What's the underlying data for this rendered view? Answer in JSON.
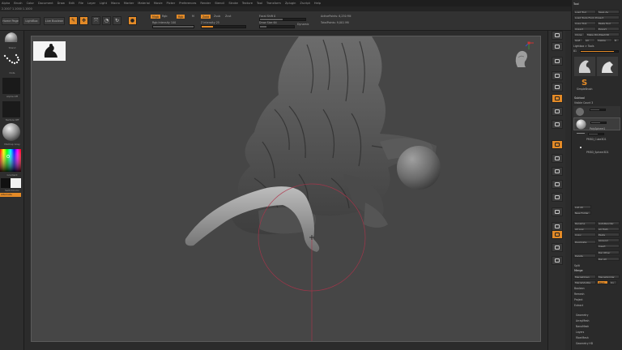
{
  "menu": [
    "Alpha",
    "Brush",
    "Color",
    "Document",
    "Draw",
    "Edit",
    "File",
    "Layer",
    "Light",
    "Macro",
    "Marker",
    "Material",
    "Movie",
    "Picker",
    "Preferences",
    "Render",
    "Stencil",
    "Stroke",
    "Texture",
    "Tool",
    "Transform",
    "Zplugin",
    "Zscript",
    "Help"
  ],
  "subbar_text": "2.2007 1.1000 1.1000",
  "shelf": {
    "home_page": "Home Page",
    "lightbox": "LightBox",
    "live_boolean": "Live Boolean",
    "mrgb": "Mrgb",
    "rgb": "Rgb",
    "m": "M",
    "zadd": "Zadd",
    "zsub": "Zsub",
    "zcut": "Zcut",
    "rgb_intensity": "Rgb Intensity 100",
    "z_intensity": "Z Intensity 25",
    "focal_shift": "Focal Shift 0",
    "draw_size": "Draw Size 64",
    "dynamic": "Dynamic",
    "active_points": "ActivePoints: 6,250 Mil",
    "total_points": "TotalPoints: 9,001 Mil"
  },
  "left": {
    "brush_label": "Stand",
    "stroke_label": "Dots",
    "alpha_label": "Alpha Off",
    "texture_label": "Texture Off",
    "material_label": "MatCap Gray",
    "gradient_label": "Gradient",
    "switch_label": "SwitchColor",
    "alternate_label": "Alternate"
  },
  "tool": {
    "title": "Tool",
    "buttons": [
      [
        "Load Tool",
        "Save As"
      ],
      [
        "Load Tools From Project"
      ],
      [
        "Copy Tool",
        "Paste Tool"
      ],
      [
        "Import",
        "Export"
      ],
      [
        "Clone",
        "Make PolyMesh3D"
      ],
      [
        "GoZ",
        "All",
        "Visible",
        "R"
      ]
    ],
    "lightbox_tools": "Lightbox > Tools",
    "current_tool": "SimpleBrush",
    "tool_count": "81",
    "subtool_header": "Subtool",
    "visible_count": "Visible Count 3",
    "subtools": [
      "PolySphere1",
      "PM3D_Cube3D1",
      "PM3D_Sphere3D1"
    ],
    "list_all": "List All",
    "new_folder": "New Folder",
    "actions": [
      [
        "Rename",
        "AutoReorder"
      ],
      [
        "All Low",
        "All High"
      ],
      [
        "Copy",
        "Paste"
      ],
      [
        "Duplicate",
        "Append"
      ],
      [
        "",
        "Insert"
      ],
      [
        "Delete",
        "Del Other"
      ],
      [
        "",
        "Del All"
      ]
    ],
    "split": "Split",
    "merge": "Merge",
    "merge_buttons": [
      [
        "MergeDown",
        "MergeSimilar"
      ],
      [
        "MergeVisible",
        "Weld",
        "Uv"
      ]
    ],
    "more": [
      "Boolean",
      "Remesh",
      "Project",
      "Extract"
    ],
    "sections": [
      "Geometry",
      "ArrayMesh",
      "NanoMesh",
      "Layers",
      "FiberMesh",
      "Geometry HD"
    ]
  },
  "colors": {
    "accent": "#e38a27",
    "canvas": "#464646",
    "panel": "#2a2a2a",
    "clay": "#8a8a8a",
    "brush_ring": "#b0334a"
  }
}
